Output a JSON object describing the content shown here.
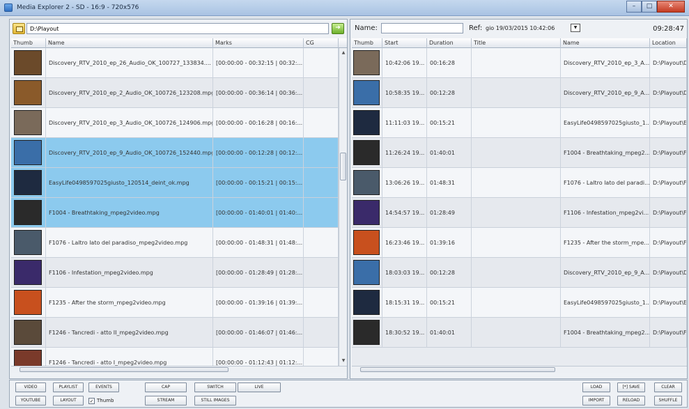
{
  "window": {
    "title": "Media Explorer 2 - SD - 16:9 - 720x576"
  },
  "left": {
    "path": "D:\\Playout",
    "columns": [
      "Thumb",
      "Name",
      "Marks",
      "CG"
    ],
    "rows": [
      {
        "name": "Discovery_RTV_2010_ep_26_Audio_OK_100727_133834....",
        "marks": "[00:00:00 - 00:32:15 | 00:32:...",
        "thumb": "#6b4a2a",
        "state": "alt"
      },
      {
        "name": "Discovery_RTV_2010_ep_2_Audio_OK_100726_123208.mpg",
        "marks": "[00:00:00 - 00:36:14 | 00:36:...",
        "thumb": "#8a5a2a",
        "state": "norm"
      },
      {
        "name": "Discovery_RTV_2010_ep_3_Audio_OK_100726_124906.mpg",
        "marks": "[00:00:00 - 00:16:28 | 00:16:...",
        "thumb": "#7a6a5a",
        "state": "alt"
      },
      {
        "name": "Discovery_RTV_2010_ep_9_Audio_OK_100726_152440.mpg",
        "marks": "[00:00:00 - 00:12:28 | 00:12:...",
        "thumb": "#3a6ea8",
        "state": "sel"
      },
      {
        "name": "EasyLife0498597025giusto_120514_deint_ok.mpg",
        "marks": "[00:00:00 - 00:15:21 | 00:15:...",
        "thumb": "#1e2a40",
        "state": "sel"
      },
      {
        "name": "F1004 - Breathtaking_mpeg2video.mpg",
        "marks": "[00:00:00 - 01:40:01 | 01:40:...",
        "thumb": "#2a2a2a",
        "state": "sel"
      },
      {
        "name": "F1076 - Laltro lato del paradiso_mpeg2video.mpg",
        "marks": "[00:00:00 - 01:48:31 | 01:48:...",
        "thumb": "#4a5a6a",
        "state": "alt"
      },
      {
        "name": "F1106 - Infestation_mpeg2video.mpg",
        "marks": "[00:00:00 - 01:28:49 | 01:28:...",
        "thumb": "#3a2a6a",
        "state": "norm"
      },
      {
        "name": "F1235 - After the storm_mpeg2video.mpg",
        "marks": "[00:00:00 - 01:39:16 | 01:39:...",
        "thumb": "#c8501e",
        "state": "alt"
      },
      {
        "name": "F1246 - Tancredi - atto II_mpeg2video.mpg",
        "marks": "[00:00:00 - 01:46:07 | 01:46:...",
        "thumb": "#5a4a3a",
        "state": "norm"
      },
      {
        "name": "F1246 - Tancredi - atto I_mpeg2video.mpg",
        "marks": "[00:00:00 - 01:12:43 | 01:12:...",
        "thumb": "#7a3a2a",
        "state": "alt"
      }
    ]
  },
  "right": {
    "name_label": "Name:",
    "ref_label": "Ref:",
    "ref_value": "gio 19/03/2015 10:42:06",
    "clock": "09:28:47",
    "columns": [
      "Thumb",
      "Start",
      "Duration",
      "Title",
      "Name",
      "Location"
    ],
    "rows": [
      {
        "start": "10:42:06 19...",
        "duration": "00:16:28",
        "name": "Discovery_RTV_2010_ep_3_A...",
        "location": "D:\\Playout\\Di",
        "thumb": "#7a6a5a"
      },
      {
        "start": "10:58:35 19...",
        "duration": "00:12:28",
        "name": "Discovery_RTV_2010_ep_9_A...",
        "location": "D:\\Playout\\Di",
        "thumb": "#3a6ea8"
      },
      {
        "start": "11:11:03 19...",
        "duration": "00:15:21",
        "name": "EasyLife0498597025giusto_1...",
        "location": "D:\\Playout\\Ea",
        "thumb": "#1e2a40"
      },
      {
        "start": "11:26:24 19...",
        "duration": "01:40:01",
        "name": "F1004 - Breathtaking_mpeg2...",
        "location": "D:\\Playout\\F1",
        "thumb": "#2a2a2a"
      },
      {
        "start": "13:06:26 19...",
        "duration": "01:48:31",
        "name": "F1076 - Laltro lato del paradi...",
        "location": "D:\\Playout\\F1",
        "thumb": "#4a5a6a"
      },
      {
        "start": "14:54:57 19...",
        "duration": "01:28:49",
        "name": "F1106 - Infestation_mpeg2vi...",
        "location": "D:\\Playout\\F1",
        "thumb": "#3a2a6a"
      },
      {
        "start": "16:23:46 19...",
        "duration": "01:39:16",
        "name": "F1235 - After the storm_mpe...",
        "location": "D:\\Playout\\F1",
        "thumb": "#c8501e"
      },
      {
        "start": "18:03:03 19...",
        "duration": "00:12:28",
        "name": "Discovery_RTV_2010_ep_9_A...",
        "location": "D:\\Playout\\Di",
        "thumb": "#3a6ea8"
      },
      {
        "start": "18:15:31 19...",
        "duration": "00:15:21",
        "name": "EasyLife0498597025giusto_1...",
        "location": "D:\\Playout\\Ea",
        "thumb": "#1e2a40"
      },
      {
        "start": "18:30:52 19...",
        "duration": "01:40:01",
        "name": "F1004 - Breathtaking_mpeg2...",
        "location": "D:\\Playout\\F1",
        "thumb": "#2a2a2a"
      }
    ]
  },
  "toolbar": {
    "video": "VIDEO",
    "playlist": "PLAYLIST",
    "events": "EVENTS",
    "cap": "CAP",
    "switch": "SWITCH",
    "live": "LIVE",
    "youtube": "YOUTUBE",
    "layout": "LAYOUT",
    "thumb": "Thumb",
    "stream": "STREAM",
    "still_images": "STILL IMAGES",
    "load": "LOAD",
    "save": "[*] SAVE",
    "clear": "CLEAR",
    "import": "IMPORT",
    "reload": "RELOAD",
    "shuffle": "SHUFFLE"
  },
  "colors": {
    "selected_row": "#8ccaee",
    "title_bar": "#a9c3e3",
    "close_button": "#c43b22"
  }
}
